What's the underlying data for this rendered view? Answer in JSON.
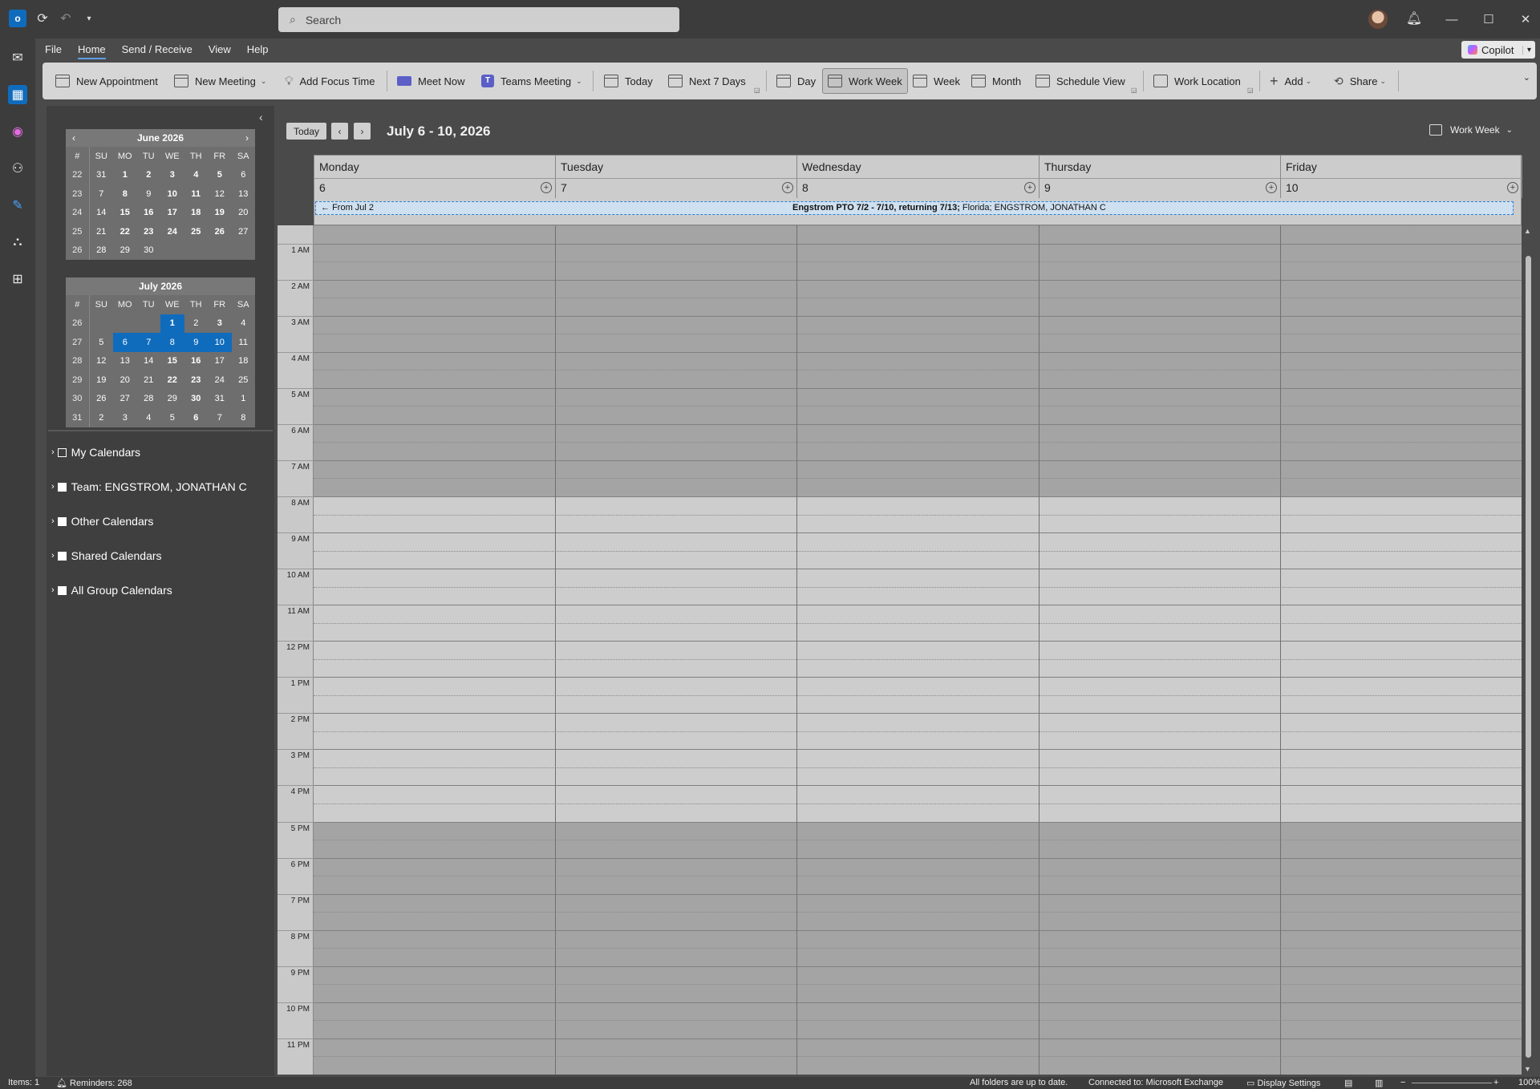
{
  "search": {
    "placeholder": "Search"
  },
  "copilot_label": "Copilot",
  "menu": {
    "tabs": [
      "File",
      "Home",
      "Send / Receive",
      "View",
      "Help"
    ],
    "active": "Home"
  },
  "ribbon": {
    "new_appointment": "New Appointment",
    "new_meeting": "New Meeting",
    "add_focus_time": "Add Focus Time",
    "meet_now": "Meet Now",
    "teams_meeting": "Teams Meeting",
    "today": "Today",
    "next_7_days": "Next 7 Days",
    "day": "Day",
    "work_week": "Work Week",
    "week": "Week",
    "month": "Month",
    "schedule_view": "Schedule View",
    "work_location": "Work Location",
    "add": "Add",
    "share": "Share"
  },
  "mini_calendars": [
    {
      "title": "June 2026",
      "headers": [
        "#",
        "SU",
        "MO",
        "TU",
        "WE",
        "TH",
        "FR",
        "SA"
      ],
      "rows": [
        [
          "22",
          "31",
          "1",
          "2",
          "3",
          "4",
          "5",
          "6"
        ],
        [
          "23",
          "7",
          "8",
          "9",
          "10",
          "11",
          "12",
          "13"
        ],
        [
          "24",
          "14",
          "15",
          "16",
          "17",
          "18",
          "19",
          "20"
        ],
        [
          "25",
          "21",
          "22",
          "23",
          "24",
          "25",
          "26",
          "27"
        ],
        [
          "26",
          "28",
          "29",
          "30",
          "",
          "",
          "",
          ""
        ]
      ]
    },
    {
      "title": "July 2026",
      "headers": [
        "#",
        "SU",
        "MO",
        "TU",
        "WE",
        "TH",
        "FR",
        "SA"
      ],
      "rows": [
        [
          "26",
          "",
          "",
          "",
          "1",
          "2",
          "3",
          "4"
        ],
        [
          "27",
          "5",
          "6",
          "7",
          "8",
          "9",
          "10",
          "11"
        ],
        [
          "28",
          "12",
          "13",
          "14",
          "15",
          "16",
          "17",
          "18"
        ],
        [
          "29",
          "19",
          "20",
          "21",
          "22",
          "23",
          "24",
          "25"
        ],
        [
          "30",
          "26",
          "27",
          "28",
          "29",
          "30",
          "31",
          "1"
        ],
        [
          "31",
          "2",
          "3",
          "4",
          "5",
          "6",
          "7",
          "8"
        ]
      ]
    }
  ],
  "calendar_groups": [
    "My Calendars",
    "Team: ENGSTROM, JONATHAN C",
    "Other Calendars",
    "Shared Calendars",
    "All Group Calendars"
  ],
  "calendar": {
    "today_button": "Today",
    "range_title": "July 6 - 10, 2026",
    "view_selector": "Work Week",
    "days": [
      {
        "name": "Monday",
        "num": "6"
      },
      {
        "name": "Tuesday",
        "num": "7"
      },
      {
        "name": "Wednesday",
        "num": "8"
      },
      {
        "name": "Thursday",
        "num": "9"
      },
      {
        "name": "Friday",
        "num": "10"
      }
    ],
    "all_day_event": {
      "from": "From Jul 2",
      "title": "Engstrom PTO 7/2 - 7/10, returning 7/13;",
      "detail": " Florida; ENGSTROM, JONATHAN C"
    },
    "hours": [
      "1 AM",
      "2 AM",
      "3 AM",
      "4 AM",
      "5 AM",
      "6 AM",
      "7 AM",
      "8 AM",
      "9 AM",
      "10 AM",
      "11 AM",
      "12 PM",
      "1 PM",
      "2 PM",
      "3 PM",
      "4 PM",
      "5 PM",
      "6 PM",
      "7 PM",
      "8 PM",
      "9 PM",
      "10 PM",
      "11 PM"
    ]
  },
  "status": {
    "items": "Items: 1",
    "reminders": "Reminders: 268",
    "sync": "All folders are up to date.",
    "connection": "Connected to: Microsoft Exchange",
    "display_settings": "Display Settings",
    "zoom": "100%"
  }
}
